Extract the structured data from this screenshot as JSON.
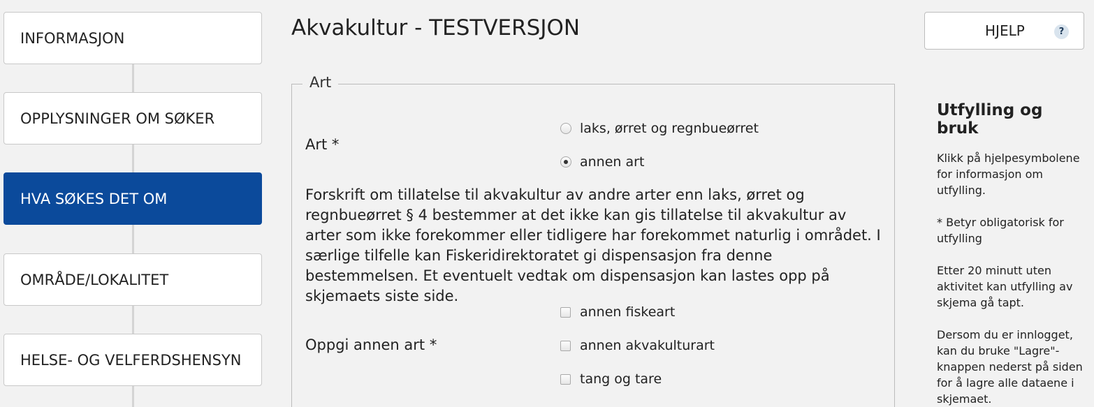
{
  "sidebar": {
    "items": [
      {
        "label": "INFORMASJON"
      },
      {
        "label": "OPPLYSNINGER OM SØKER"
      },
      {
        "label": "HVA SØKES DET OM",
        "active": true
      },
      {
        "label": "OMRÅDE/LOKALITET"
      },
      {
        "label": "HELSE- OG VELFERDSHENSYN"
      }
    ]
  },
  "header": {
    "title": "Akvakultur - TESTVERSJON",
    "help_label": "HJELP",
    "help_icon_text": "?"
  },
  "form": {
    "legend": "Art",
    "art_label": "Art *",
    "art_options": [
      {
        "label": "laks, ørret og regnbueørret",
        "checked": false
      },
      {
        "label": "annen art",
        "checked": true
      }
    ],
    "info_text": "Forskrift om tillatelse til akvakultur av andre arter enn laks, ørret og regnbueørret § 4 bestemmer at det ikke kan gis tillatelse til akvakultur av arter som ikke forekommer eller tidligere har forekommet naturlig i området. I særlige tilfelle kan Fiskeridirektoratet gi dispensasjon fra denne bestemmelsen. Et eventuelt vedtak om dispensasjon kan lastes opp på skjemaets siste side.",
    "other_label": "Oppgi annen art *",
    "other_options": [
      {
        "label": "annen fiskeart",
        "checked": false
      },
      {
        "label": "annen akvakulturart",
        "checked": false
      },
      {
        "label": "tang og tare",
        "checked": false
      }
    ]
  },
  "help_panel": {
    "title": "Utfylling og bruk",
    "paragraphs": [
      "Klikk på hjelpesymbolene for informasjon om utfylling.",
      "* Betyr obligatorisk for utfylling",
      "Etter 20 minutt uten aktivitet kan utfylling av skjema gå tapt.",
      "Dersom du er innlogget, kan du bruke \"Lagre\"-knappen nederst på siden for å lagre alle dataene i skjemaet."
    ]
  },
  "colors": {
    "active_nav": "#0b4a9b",
    "background": "#f2f2f2"
  }
}
